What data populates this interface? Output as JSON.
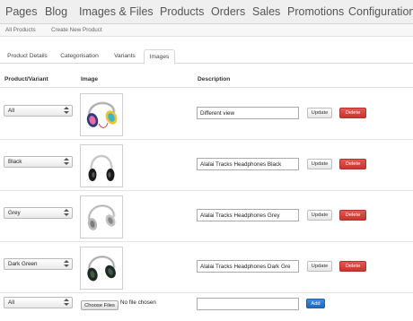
{
  "nav": {
    "items": [
      "Pages",
      "Blog",
      "Images & Files",
      "Products",
      "Orders",
      "Sales",
      "Promotions",
      "Configuration"
    ]
  },
  "subnav": {
    "items": [
      "All Products",
      "Create New Product"
    ]
  },
  "tabs": {
    "items": [
      "Product Details",
      "Categorisation",
      "Variants",
      "Images"
    ],
    "active": "Images"
  },
  "table": {
    "headers": {
      "variant": "Product/Variant",
      "image": "Image",
      "description": "Description"
    },
    "rows": [
      {
        "variant": "All",
        "description": "Different view",
        "image_icon": "headphones-colorful-icon"
      },
      {
        "variant": "Black",
        "description": "Alalai Tracks Headphones Black",
        "image_icon": "headphones-black-icon"
      },
      {
        "variant": "Grey",
        "description": "Alalai Tracks Headphones Grey",
        "image_icon": "headphones-grey-icon"
      },
      {
        "variant": "Dark Green",
        "description": "Alalai Tracks Headphones Dark Gre",
        "image_icon": "headphones-dark-green-icon"
      }
    ],
    "update_label": "Update",
    "delete_label": "Delete"
  },
  "new_image": {
    "variant": "All",
    "choose_files_label": "Choose Files",
    "file_status": "No file chosen",
    "description_value": "",
    "add_label": "Add"
  },
  "colors": {
    "delete": "#d23c35",
    "add": "#2b73cf",
    "nav_background": "#efefef"
  }
}
